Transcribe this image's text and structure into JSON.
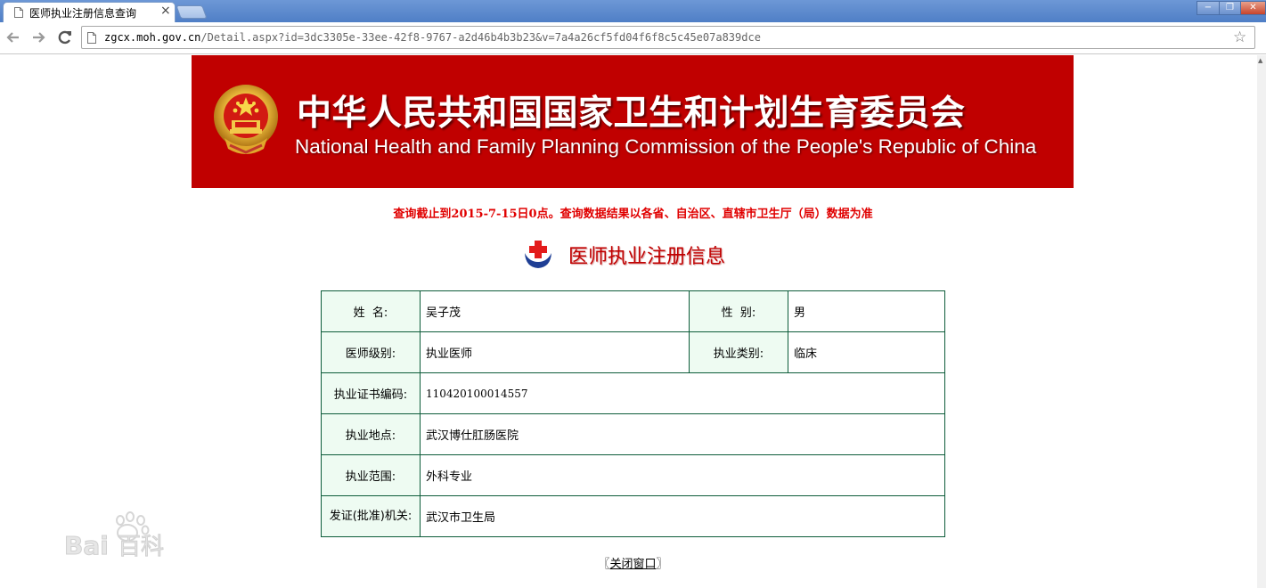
{
  "browser": {
    "tab_title": "医师执业注册信息查询",
    "tab_close": "×",
    "url_host": "zgcx.moh.gov.cn",
    "url_path": "/Detail.aspx?id=3dc3305e-33ee-42f8-9767-a2d46b4b3b23&v=7a4a26cf5fd04f6f8c5c45e07a839dce",
    "window_buttons": {
      "minimize": "−",
      "maximize": "❐",
      "close": "✕"
    },
    "star": "☆"
  },
  "banner": {
    "title_cn": "中华人民共和国国家卫生和计划生育委员会",
    "title_en": "National Health and Family Planning Commission of the People's Republic of China"
  },
  "notice": "查询截止到2015-7-15日0点。查询数据结果以各省、自治区、直辖市卫生厅（局）数据为准",
  "section_title": "医师执业注册信息",
  "record": {
    "name_label": "姓  名:",
    "name_value": "吴子茂",
    "gender_label": "性  别:",
    "gender_value": "男",
    "level_label": "医师级别:",
    "level_value": "执业医师",
    "category_label": "执业类别:",
    "category_value": "临床",
    "cert_label": "执业证书编码:",
    "cert_value": "110420100014557",
    "location_label": "执业地点:",
    "location_value": "武汉博仕肛肠医院",
    "scope_label": "执业范围:",
    "scope_value": "外科专业",
    "authority_label": "发证(批准)机关:",
    "authority_value": "武汉市卫生局"
  },
  "close_window": {
    "open_bracket": "〖",
    "label": "关闭窗口",
    "close_bracket": "〗"
  },
  "watermark": "Bai百科",
  "colors": {
    "banner_red": "#c00000",
    "notice_red": "#e00000",
    "table_border": "#0d5c3a",
    "label_bg": "#eefbf2"
  }
}
